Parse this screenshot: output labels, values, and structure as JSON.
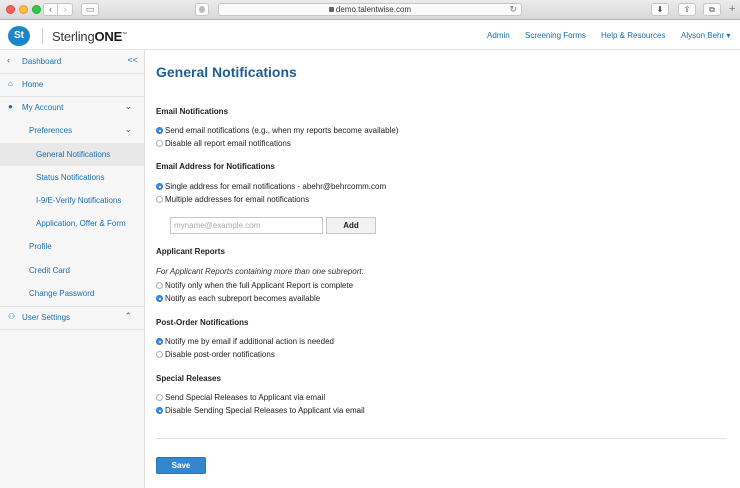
{
  "browser": {
    "url": "demo.talentwise.com"
  },
  "header": {
    "logo_mark": "St",
    "brand_prefix": "Sterling",
    "brand_suffix": "ONE",
    "brand_tm": "™",
    "nav": {
      "admin": "Admin",
      "screening_forms": "Screening Forms",
      "help": "Help & Resources",
      "user": "Alyson Behr ▾"
    },
    "brand_color": "#1d86c8"
  },
  "sidebar": {
    "collapse_glyph": "<<",
    "items": {
      "dashboard": "Dashboard",
      "home": "Home",
      "my_account": "My Account",
      "preferences": "Preferences",
      "general_notifications": "General Notifications",
      "status_notifications": "Status Notifications",
      "i9_notifications": "I-9/E-Verify Notifications",
      "application_offer": "Application, Offer & Form",
      "profile": "Profile",
      "credit_card": "Credit Card",
      "change_password": "Change Password",
      "user_settings": "User Settings"
    },
    "active": "general_notifications"
  },
  "main": {
    "title": "General Notifications",
    "email_notifications": {
      "heading": "Email Notifications",
      "options": [
        {
          "label": "Send email notifications (e.g., when my reports become available)",
          "selected": true
        },
        {
          "label": "Disable all report email notifications",
          "selected": false
        }
      ]
    },
    "email_address": {
      "heading": "Email Address for Notifications",
      "options": [
        {
          "label": "Single address for email notifications - abehr@behrcomm.com",
          "selected": true
        },
        {
          "label": "Multiple addresses for email notifications",
          "selected": false
        }
      ],
      "input_placeholder": "myname@example.com",
      "input_value": "",
      "add_label": "Add"
    },
    "applicant_reports": {
      "heading": "Applicant Reports",
      "note": "For Applicant Reports containing more than one subreport:",
      "options": [
        {
          "label": "Notify only when the full Applicant Report is complete",
          "selected": false
        },
        {
          "label": "Notify as each subreport becomes available",
          "selected": true
        }
      ]
    },
    "post_order": {
      "heading": "Post-Order Notifications",
      "options": [
        {
          "label": "Notify me by email if additional action is needed",
          "selected": true
        },
        {
          "label": "Disable post-order notifications",
          "selected": false
        }
      ]
    },
    "special_releases": {
      "heading": "Special Releases",
      "options": [
        {
          "label": "Send Special Releases to Applicant via email",
          "selected": false
        },
        {
          "label": "Disable Sending Special Releases to Applicant via email",
          "selected": true
        }
      ]
    },
    "save_label": "Save"
  },
  "icons": {
    "home": "home-icon",
    "user": "user-icon",
    "users": "users-icon",
    "chevron": "chevron-icon"
  }
}
